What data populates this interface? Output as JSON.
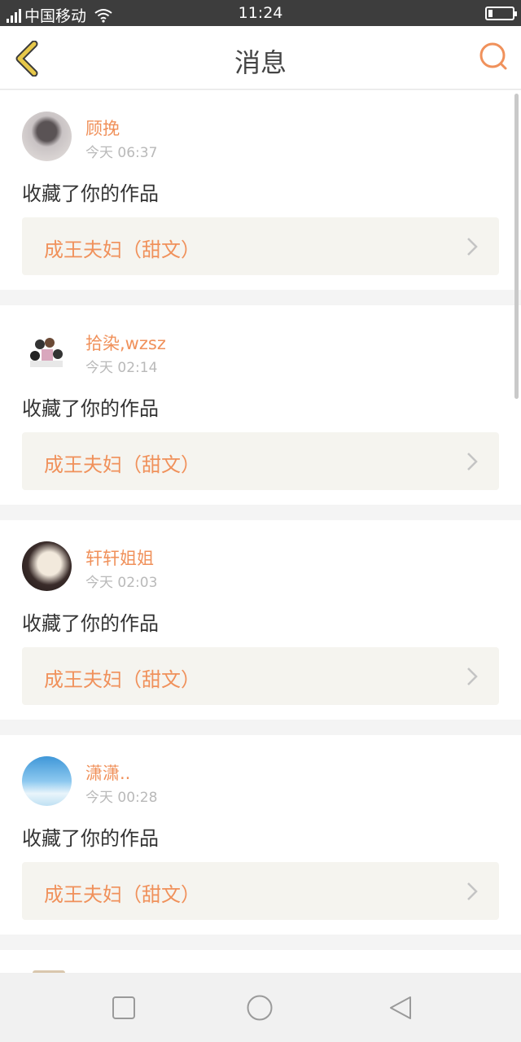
{
  "status_bar": {
    "carrier": "中国移动",
    "time": "11:24",
    "battery_level": 0.12
  },
  "nav": {
    "title": "消息",
    "back_icon": "chevron-left-icon",
    "search_icon": "search-icon",
    "accent": "#f0915b",
    "back_color": "#e7c84a"
  },
  "messages": [
    {
      "user": "顾挽",
      "time": "今天 06:37",
      "action": "收藏了你的作品",
      "work": "成王夫妇（甜文）"
    },
    {
      "user": "拾染,wzsz",
      "time": "今天 02:14",
      "action": "收藏了你的作品",
      "work": "成王夫妇（甜文）"
    },
    {
      "user": "轩轩姐姐",
      "time": "今天 02:03",
      "action": "收藏了你的作品",
      "work": "成王夫妇（甜文）"
    },
    {
      "user": "潇潇..",
      "time": "今天 00:28",
      "action": "收藏了你的作品",
      "work": "成王夫妇（甜文）"
    }
  ],
  "bottom_nav": {
    "recents_icon": "square-icon",
    "home_icon": "circle-icon",
    "back_icon": "triangle-back-icon"
  }
}
